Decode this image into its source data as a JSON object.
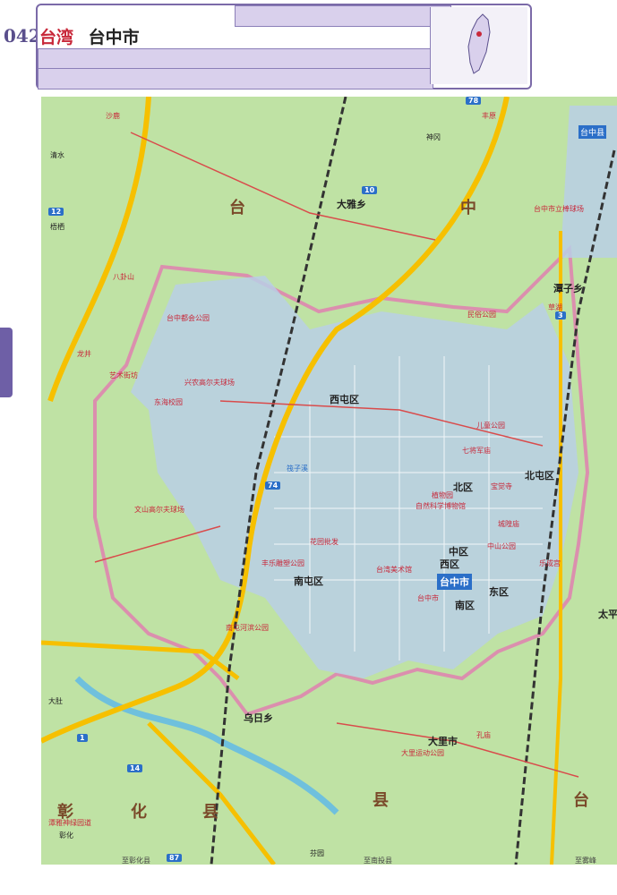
{
  "header": {
    "page_number": "042",
    "region": "台湾",
    "city": "台中市"
  },
  "map": {
    "districts": [
      "西屯区",
      "北屯区",
      "北区",
      "中区",
      "西区",
      "南区",
      "东区",
      "南屯区"
    ],
    "city_label": "台中市",
    "county_labels": [
      "台",
      "中",
      "县",
      "彰",
      "化",
      "县",
      "台",
      "中"
    ],
    "places": [
      "沙鹿",
      "台中县",
      "丰原",
      "大雅乡",
      "潭子乡",
      "乌日乡",
      "大里市",
      "太平",
      "龙井",
      "清水",
      "梧栖",
      "神冈",
      "大肚",
      "雾峰",
      "彰化",
      "芬园"
    ],
    "pois": [
      "台中都会公园",
      "兴农高尔夫球场",
      "东海校园",
      "艺术街坊",
      "文山高尔夫球场",
      "花园批发",
      "丰乐雕塑公园",
      "筏子溪",
      "台湾美术馆",
      "自然科学博物馆",
      "植物园",
      "宝觉寺",
      "中山公园",
      "乐成宫",
      "南屯河滨公园",
      "台中市",
      "城隍庙",
      "孔庙",
      "大里运动公园",
      "七将军庙",
      "儿童公园",
      "民俗公园",
      "台中市立棒球场",
      "潭雅神绿园道",
      "八卦山",
      "草湖",
      "丰年公园"
    ],
    "routes": [
      "78",
      "10",
      "12",
      "74",
      "3",
      "14",
      "87",
      "1"
    ],
    "bottom_notes": [
      "至彰化县",
      "至南投县",
      "至雾峰"
    ]
  }
}
